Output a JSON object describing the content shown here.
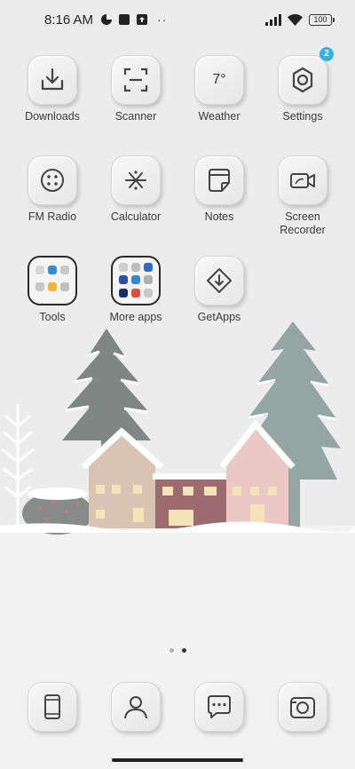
{
  "status_bar": {
    "time": "8:16 AM",
    "battery": "100",
    "more": "··"
  },
  "badge_color": "#33b3e3",
  "apps": [
    {
      "label": "Downloads",
      "icon": "download-icon"
    },
    {
      "label": "Scanner",
      "icon": "scanner-icon"
    },
    {
      "label": "Weather",
      "icon": "weather-icon",
      "value": "7°"
    },
    {
      "label": "Settings",
      "icon": "gear-icon",
      "badge": "2"
    },
    {
      "label": "FM Radio",
      "icon": "radio-icon"
    },
    {
      "label": "Calculator",
      "icon": "calculator-icon"
    },
    {
      "label": "Notes",
      "icon": "notes-icon"
    },
    {
      "label": "Screen Recorder",
      "icon": "video-camera-icon"
    },
    {
      "label": "Tools",
      "icon": "folder-icon"
    },
    {
      "label": "More apps",
      "icon": "folder-icon"
    },
    {
      "label": "GetApps",
      "icon": "getapps-icon"
    }
  ],
  "dock": [
    {
      "name": "phone-tablet-icon"
    },
    {
      "name": "contacts-icon"
    },
    {
      "name": "messages-icon"
    },
    {
      "name": "camera-icon"
    }
  ],
  "pages": {
    "count": 2,
    "active": 2
  }
}
